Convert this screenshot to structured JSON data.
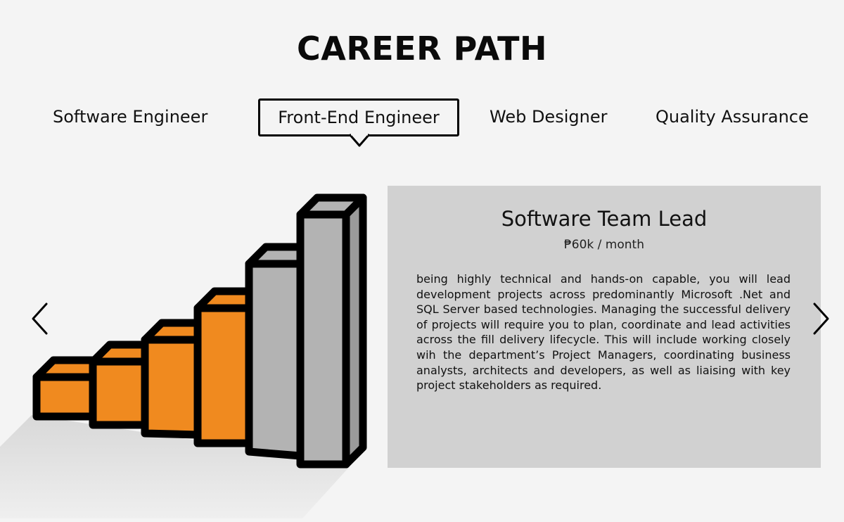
{
  "page": {
    "title": "CAREER PATH"
  },
  "tabs": [
    {
      "label": "Software Engineer",
      "active": false
    },
    {
      "label": "Front-End Engineer",
      "active": true
    },
    {
      "label": "Web Designer",
      "active": false
    },
    {
      "label": "Quality Assurance",
      "active": false
    }
  ],
  "illustration": {
    "icon": "staircase-bar-chart-icon",
    "steps": 6,
    "filled_steps": 4,
    "fill_color": "#f08a1f",
    "empty_color": "#b3b3b3",
    "outline_color": "#000000"
  },
  "card": {
    "title": "Software Team Lead",
    "salary": "₱60k / month",
    "description": "being highly technical and hands-on capable, you will lead development projects across predominantly Microsoft .Net and SQL Server based technologies. Managing the successful delivery of projects will require you to plan, coordinate and lead activities across the fill delivery lifecycle. This will include working closely wih the department’s Project Managers, coordinating business analysts, architects and developers, as well as liaising with key project stakeholders as required."
  },
  "navigation": {
    "prev_icon": "chevron-left-icon",
    "next_icon": "chevron-right-icon"
  }
}
